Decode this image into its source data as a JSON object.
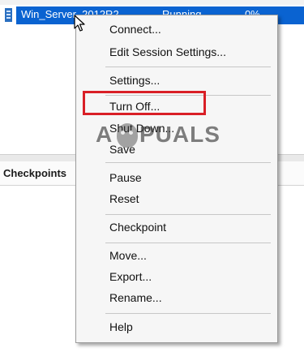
{
  "vm_list": {
    "selected_row": {
      "name": "Win_Server_2012R2",
      "state": "Running",
      "cpu": "0%"
    }
  },
  "lower_pane": {
    "checkpoints_title": "Checkpoints"
  },
  "context_menu": {
    "items": [
      {
        "label": "Connect..."
      },
      {
        "label": "Edit Session Settings..."
      },
      {
        "label": "Settings..."
      },
      {
        "label": "Turn Off..."
      },
      {
        "label": "Shut Down..."
      },
      {
        "label": "Save"
      },
      {
        "label": "Pause"
      },
      {
        "label": "Reset"
      },
      {
        "label": "Checkpoint"
      },
      {
        "label": "Move..."
      },
      {
        "label": "Export..."
      },
      {
        "label": "Rename..."
      },
      {
        "label": "Help"
      }
    ],
    "highlighted_item": "Turn Off...",
    "highlight_color": "#d91f26"
  },
  "watermark": {
    "first_letter": "A",
    "rest": "PUALS"
  },
  "colors": {
    "selection": "#0a63d1"
  }
}
